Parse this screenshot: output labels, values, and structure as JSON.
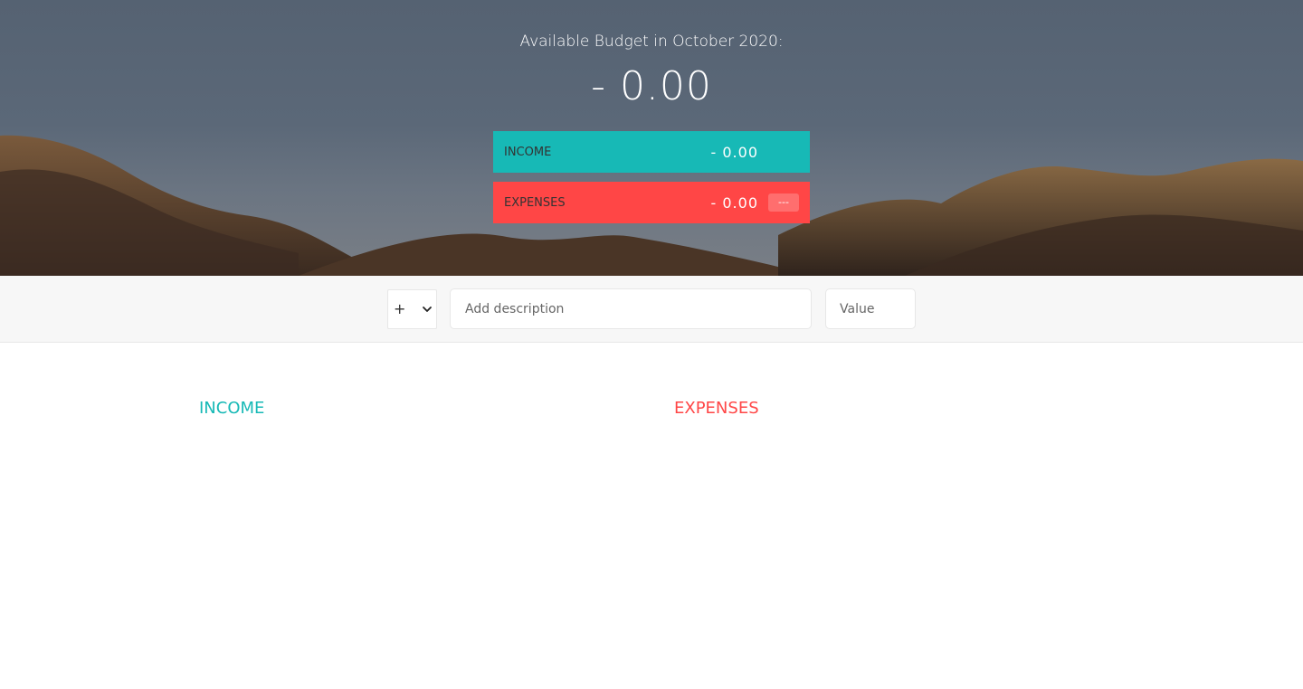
{
  "budget": {
    "title": "Available Budget in October 2020:",
    "value": "- 0.00"
  },
  "summary": {
    "income": {
      "label": "Income",
      "value": "- 0.00",
      "color": "#17b9b6"
    },
    "expenses": {
      "label": "Expenses",
      "value": "- 0.00",
      "percentage": "---",
      "color": "#ff4646"
    }
  },
  "add_form": {
    "type_selected": "+",
    "type_options": [
      "+",
      "-"
    ],
    "description_placeholder": "Add description",
    "value_placeholder": "Value"
  },
  "lists": {
    "income_title": "Income",
    "expenses_title": "Expenses"
  },
  "icons": {
    "dropdown": "chevron-down-icon"
  }
}
